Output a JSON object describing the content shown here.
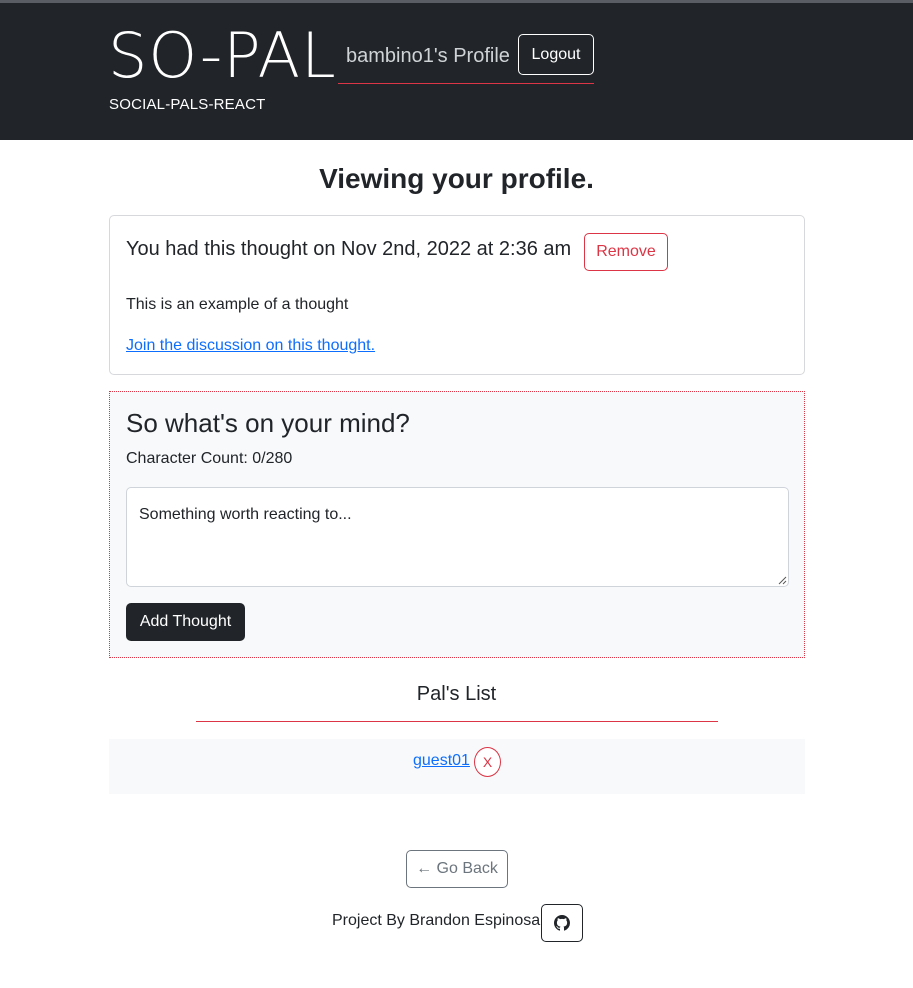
{
  "header": {
    "brand": "SO-PAL",
    "subtitle": "SOCIAL-PALS-REACT",
    "profile_title": "bambino1's Profile",
    "logout_label": "Logout"
  },
  "main": {
    "page_title": "Viewing your profile."
  },
  "thought_card": {
    "heading": "You had this thought on Nov 2nd, 2022 at 2:36 am",
    "remove_label": "Remove",
    "text": "This is an example of a thought",
    "link_text": "Join the discussion on this thought."
  },
  "thought_form": {
    "title": "So what's on your mind?",
    "char_count": "Character Count: 0/280",
    "placeholder": "Something worth reacting to...",
    "submit_label": "Add Thought"
  },
  "pals": {
    "title": "Pal's List",
    "items": [
      {
        "name": "guest01",
        "remove_label": "X"
      }
    ]
  },
  "footer": {
    "back_label": "← Go Back",
    "credit": "Project By Brandon Espinosa",
    "github_icon": "github-icon"
  },
  "colors": {
    "header_bg": "#212529",
    "accent_red": "#dc3545",
    "link_blue": "#0d6efd",
    "panel_bg": "#f8f9fa"
  }
}
